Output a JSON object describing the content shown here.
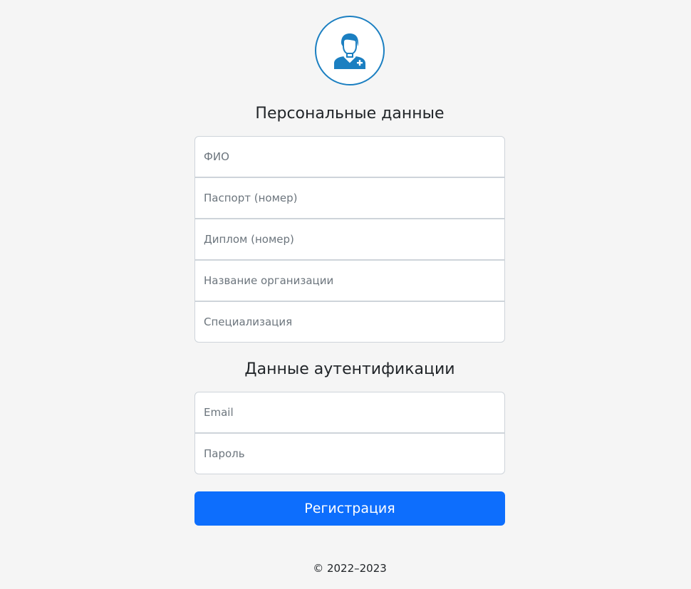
{
  "logo": {
    "icon": "doctor-avatar-icon",
    "accent_color": "#1b7fc1"
  },
  "personal": {
    "title": "Персональные данные",
    "fields": {
      "fio": {
        "placeholder": "ФИО",
        "value": ""
      },
      "passport": {
        "placeholder": "Паспорт (номер)",
        "value": ""
      },
      "diploma": {
        "placeholder": "Диплом (номер)",
        "value": ""
      },
      "organization": {
        "placeholder": "Название организации",
        "value": ""
      },
      "specialization": {
        "placeholder": "Специализация",
        "value": ""
      }
    }
  },
  "auth": {
    "title": "Данные аутентификации",
    "fields": {
      "email": {
        "placeholder": "Email",
        "value": ""
      },
      "password": {
        "placeholder": "Пароль",
        "value": ""
      }
    }
  },
  "submit": {
    "label": "Регистрация",
    "color": "#0d6efd"
  },
  "footer": {
    "copyright": "© 2022–2023"
  }
}
